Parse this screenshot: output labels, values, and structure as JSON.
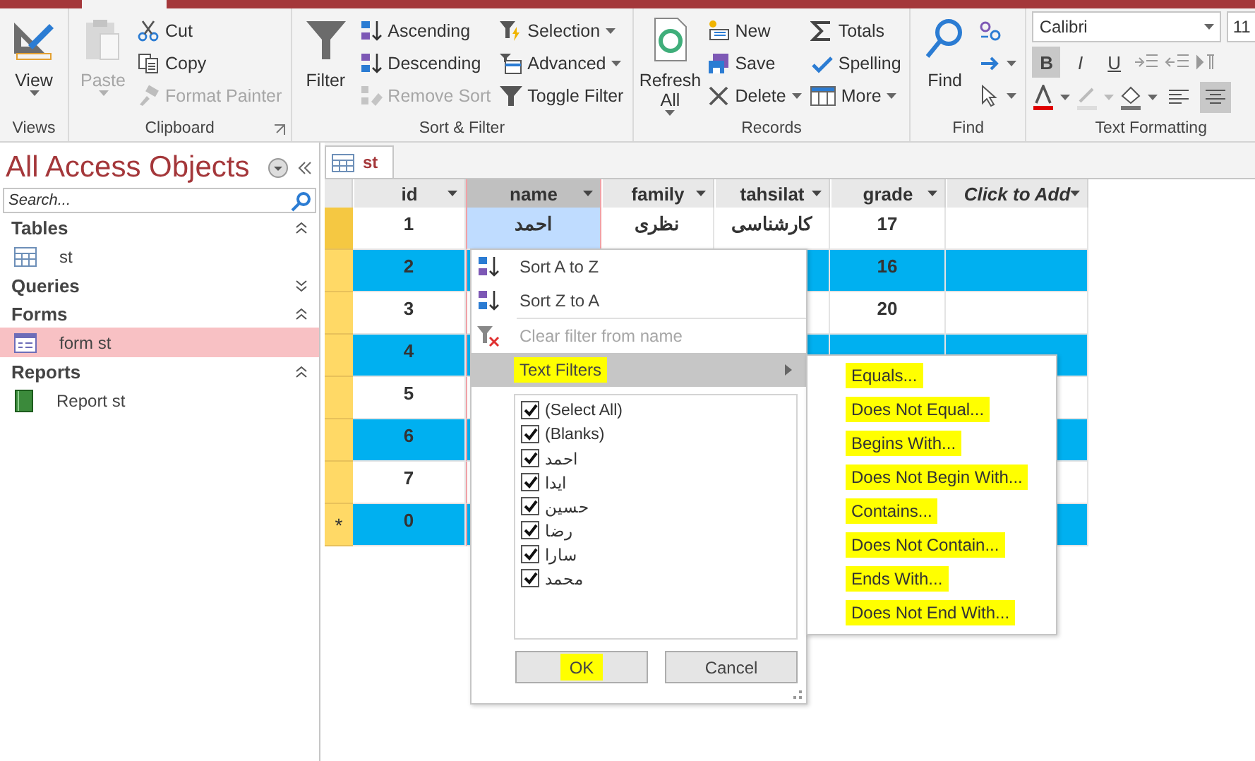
{
  "ribbon": {
    "groups": [
      {
        "kind": "commands",
        "label": "Views",
        "launcher": false,
        "commands": [
          {
            "kind": "large",
            "label": "View",
            "dropdown": true,
            "disabled": false
          }
        ]
      },
      {
        "kind": "commands",
        "label": "Clipboard",
        "launcher": true,
        "commands": [
          {
            "kind": "large",
            "label": "Paste",
            "dropdown": true,
            "disabled": true
          },
          {
            "kind": "small",
            "label": "Cut",
            "dropdown": false,
            "disabled": false
          },
          {
            "kind": "small",
            "label": "Copy",
            "dropdown": false,
            "disabled": false
          },
          {
            "kind": "small",
            "label": "Format Painter",
            "dropdown": false,
            "disabled": true
          }
        ]
      },
      {
        "kind": "commands",
        "label": "Sort & Filter",
        "launcher": false,
        "commands": [
          {
            "kind": "large",
            "label": "Filter",
            "dropdown": false,
            "disabled": false
          },
          {
            "kind": "small",
            "label": "Ascending",
            "dropdown": false,
            "disabled": false
          },
          {
            "kind": "small",
            "label": "Descending",
            "dropdown": false,
            "disabled": false
          },
          {
            "kind": "small",
            "label": "Remove Sort",
            "dropdown": false,
            "disabled": true
          },
          {
            "kind": "small",
            "label": "Selection",
            "dropdown": true,
            "disabled": false
          },
          {
            "kind": "small",
            "label": "Advanced",
            "dropdown": true,
            "disabled": false
          },
          {
            "kind": "small",
            "label": "Toggle Filter",
            "dropdown": false,
            "disabled": false
          }
        ]
      },
      {
        "kind": "commands",
        "label": "Records",
        "launcher": false,
        "commands": [
          {
            "kind": "large",
            "label": "Refresh All",
            "dropdown": true,
            "disabled": false
          },
          {
            "kind": "small",
            "label": "New",
            "dropdown": false,
            "disabled": false
          },
          {
            "kind": "small",
            "label": "Save",
            "dropdown": false,
            "disabled": false
          },
          {
            "kind": "small",
            "label": "Delete",
            "dropdown": true,
            "disabled": false
          },
          {
            "kind": "small",
            "label": "Totals",
            "dropdown": false,
            "disabled": false
          },
          {
            "kind": "small",
            "label": "Spelling",
            "dropdown": false,
            "disabled": false
          },
          {
            "kind": "small",
            "label": "More",
            "dropdown": true,
            "disabled": false
          }
        ]
      },
      {
        "kind": "commands",
        "label": "Find",
        "launcher": false,
        "commands": [
          {
            "kind": "large",
            "label": "Find",
            "dropdown": false,
            "disabled": false
          },
          {
            "kind": "icon",
            "dropdown": false,
            "disabled": false
          },
          {
            "kind": "icon",
            "dropdown": true,
            "disabled": false
          },
          {
            "kind": "icon",
            "dropdown": true,
            "disabled": false
          }
        ]
      },
      {
        "kind": "formatting",
        "label": "Text Formatting",
        "font": "Calibri",
        "size": "11",
        "style_buttons": [
          {
            "label": "B",
            "selected": true
          },
          {
            "label": "I",
            "selected": false
          },
          {
            "label": "U",
            "selected": false
          }
        ],
        "align_buttons": [
          {
            "selected": false
          },
          {
            "selected": true
          }
        ]
      }
    ]
  },
  "nav": {
    "title": "All Access Objects",
    "search": {
      "placeholder": "Search..."
    },
    "sections": [
      {
        "label": "Tables",
        "expanded": true,
        "items": [
          {
            "label": "st",
            "selected": false
          }
        ]
      },
      {
        "label": "Queries",
        "expanded": false
      },
      {
        "label": "Forms",
        "expanded": true,
        "items": [
          {
            "label": "form st",
            "selected": true
          }
        ]
      },
      {
        "label": "Reports",
        "expanded": true,
        "items": [
          {
            "label": "Report st",
            "selected": false
          }
        ]
      }
    ]
  },
  "document_tab": {
    "label": "st"
  },
  "table": {
    "columns": [
      {
        "label": "id",
        "kind": "field",
        "selected": false
      },
      {
        "label": "name",
        "kind": "field",
        "selected": true
      },
      {
        "label": "family",
        "kind": "field",
        "selected": false
      },
      {
        "label": "tahsilat",
        "kind": "field",
        "selected": false
      },
      {
        "label": "grade",
        "kind": "field",
        "selected": false
      },
      {
        "label": "Click to Add",
        "kind": "add",
        "selected": false
      }
    ],
    "rows": [
      {
        "kind": "record",
        "selected": true,
        "cells": [
          "1",
          "احمد",
          "نظری",
          "کارشناسی",
          "17",
          null
        ]
      },
      {
        "kind": "record",
        "selected": false,
        "cells": [
          "2",
          null,
          null,
          null,
          "16",
          null
        ]
      },
      {
        "kind": "record",
        "selected": false,
        "cells": [
          "3",
          null,
          null,
          null,
          "20",
          null
        ]
      },
      {
        "kind": "record",
        "selected": false,
        "cells": [
          "4",
          null,
          null,
          null,
          null,
          null
        ]
      },
      {
        "kind": "record",
        "selected": false,
        "cells": [
          "5",
          null,
          null,
          null,
          null,
          null
        ]
      },
      {
        "kind": "record",
        "selected": false,
        "cells": [
          "6",
          null,
          null,
          null,
          null,
          null
        ]
      },
      {
        "kind": "record",
        "selected": false,
        "cells": [
          "7",
          null,
          null,
          null,
          null,
          null
        ]
      },
      {
        "kind": "new",
        "marker": "*",
        "selected": false,
        "cells": [
          "0",
          null,
          null,
          null,
          null,
          null
        ]
      }
    ]
  },
  "filter_menu": {
    "items": [
      {
        "kind": "sort_asc",
        "label": "Sort A to Z",
        "disabled": false,
        "selected": false,
        "highlighted": false
      },
      {
        "kind": "sort_desc",
        "label": "Sort Z to A",
        "disabled": false,
        "selected": false,
        "highlighted": false
      },
      {
        "kind": "clear",
        "label": "Clear filter from name",
        "disabled": true,
        "selected": false,
        "highlighted": false
      },
      {
        "kind": "submenu",
        "label": "Text Filters",
        "disabled": false,
        "selected": true,
        "highlighted": true
      }
    ],
    "values": [
      {
        "label": "(Select All)",
        "checked": true
      },
      {
        "label": "(Blanks)",
        "checked": true
      },
      {
        "label": "احمد",
        "checked": true
      },
      {
        "label": "ایدا",
        "checked": true
      },
      {
        "label": "حسین",
        "checked": true
      },
      {
        "label": "رضا",
        "checked": true
      },
      {
        "label": "سارا",
        "checked": true
      },
      {
        "label": "محمد",
        "checked": true
      }
    ],
    "buttons": [
      {
        "label": "OK",
        "highlighted": true
      },
      {
        "label": "Cancel",
        "highlighted": false
      }
    ]
  },
  "text_filters_menu": {
    "items": [
      {
        "label": "Equals...",
        "highlighted": true
      },
      {
        "label": "Does Not Equal...",
        "highlighted": true
      },
      {
        "label": "Begins With...",
        "highlighted": true
      },
      {
        "label": "Does Not Begin With...",
        "highlighted": true
      },
      {
        "label": "Contains...",
        "highlighted": true
      },
      {
        "label": "Does Not Contain...",
        "highlighted": true
      },
      {
        "label": "Ends With...",
        "highlighted": true
      },
      {
        "label": "Does Not End With...",
        "highlighted": true
      }
    ]
  }
}
